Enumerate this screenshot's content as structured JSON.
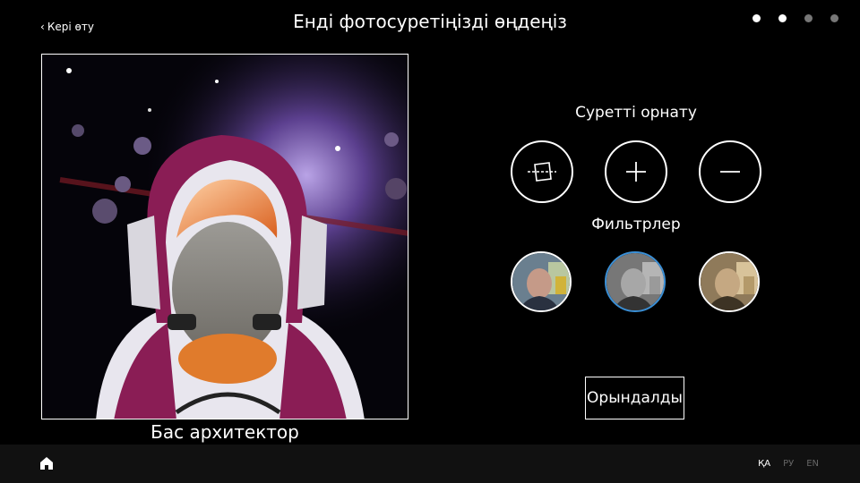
{
  "header": {
    "back_label": "Кері өту",
    "title": "Енді фотосуретіңізді өңдеңіз",
    "progress": {
      "total_steps": 4,
      "completed_steps": 2
    }
  },
  "photo": {
    "caption": "Бас архитектор"
  },
  "adjust": {
    "label": "Суретті орнату",
    "buttons": [
      {
        "icon": "crop-rotate-icon"
      },
      {
        "icon": "zoom-in-icon"
      },
      {
        "icon": "zoom-out-icon"
      }
    ]
  },
  "filters": {
    "label": "Фильтрлер",
    "items": [
      {
        "name": "original",
        "selected": false
      },
      {
        "name": "grayscale",
        "selected": true
      },
      {
        "name": "sepia",
        "selected": false
      }
    ]
  },
  "actions": {
    "done_label": "Орындалды"
  },
  "footer": {
    "home_icon": "home-icon",
    "languages": [
      {
        "code": "ҚА",
        "active": true
      },
      {
        "code": "РУ",
        "active": false
      },
      {
        "code": "EN",
        "active": false
      }
    ]
  },
  "colors": {
    "background": "#000000",
    "selected_filter_border": "#3a8fd6",
    "suit_accent": "#8a1d55"
  }
}
